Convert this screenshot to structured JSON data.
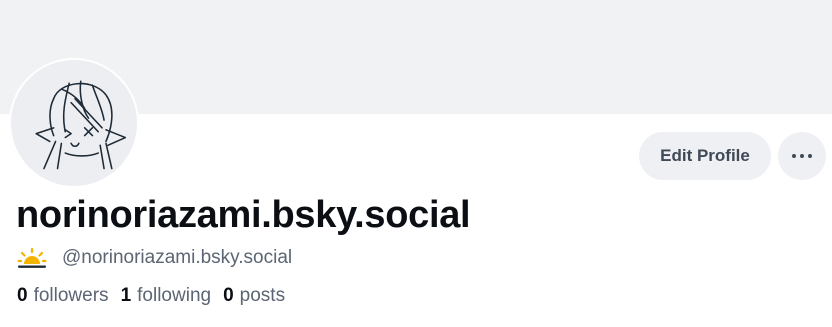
{
  "profile": {
    "display_name": "norinoriazami.bsky.social",
    "handle": "@norinoriazami.bsky.social",
    "badge_icon": "sun-emoji-icon",
    "stats": {
      "followers_count": "0",
      "followers_label": "followers",
      "following_count": "1",
      "following_label": "following",
      "posts_count": "0",
      "posts_label": "posts"
    }
  },
  "actions": {
    "edit_profile_label": "Edit Profile",
    "more_icon": "ellipsis-icon"
  },
  "colors": {
    "banner": "#f1f2f4",
    "button_bg": "#eef0f3",
    "button_text": "#404a57",
    "primary_text": "#0b0f14",
    "secondary_text": "#5b6573",
    "sun_yellow": "#f5b400"
  }
}
